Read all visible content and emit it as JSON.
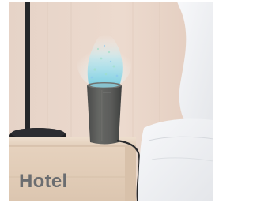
{
  "caption": "Hotel",
  "colors": {
    "caption_text": "#6b6d70",
    "wall": "#ead8cc",
    "nightstand": "#e8d6c3",
    "device_body": "#595a58",
    "lamp": "#26272a",
    "bedding": "#f1f2f4",
    "mist": "#a9ddea"
  },
  "icons": {
    "device": "portable-air-purifier",
    "mist": "ion-mist",
    "lamp": "table-lamp",
    "bed": "bed-with-pillow"
  }
}
